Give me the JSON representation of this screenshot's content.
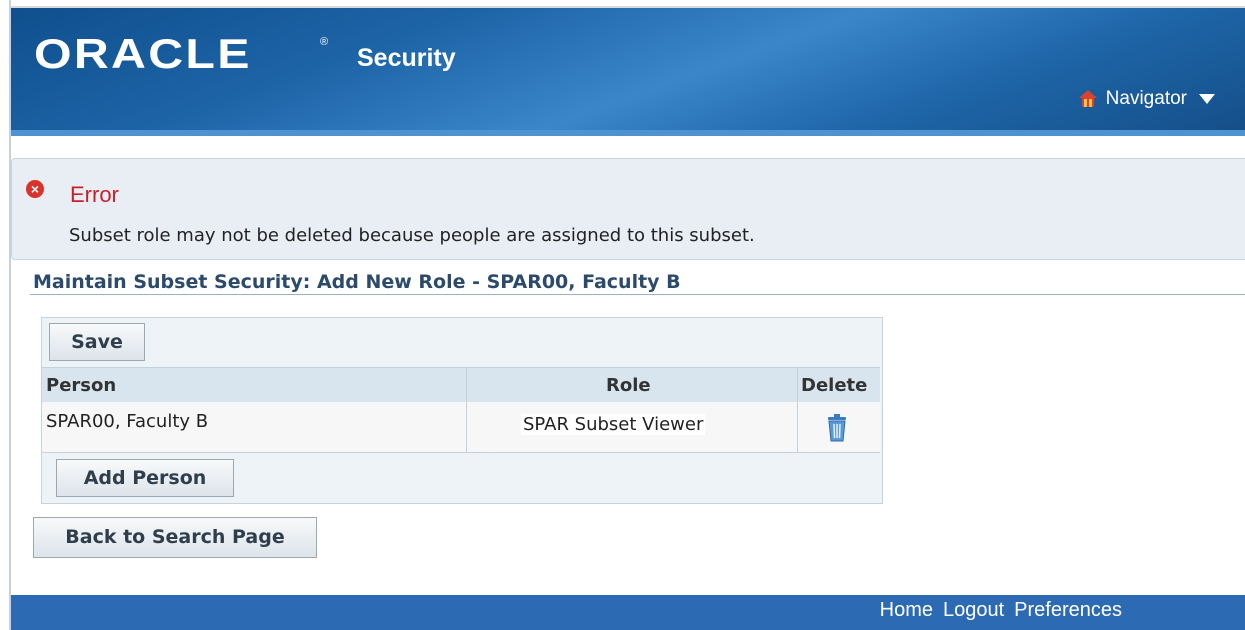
{
  "header": {
    "brand": "ORACLE",
    "brand_mark": "®",
    "app_title": "Security",
    "navigator_label": "Navigator"
  },
  "error": {
    "title": "Error",
    "message": "Subset role may not be deleted because people are assigned to this subset."
  },
  "page": {
    "title": "Maintain Subset Security: Add New Role - SPAR00, Faculty B"
  },
  "table": {
    "save_label": "Save",
    "columns": [
      "Person",
      "Role",
      "Delete"
    ],
    "rows": [
      {
        "person": "SPAR00, Faculty B",
        "role": "SPAR Subset Viewer"
      }
    ],
    "add_person_label": "Add Person"
  },
  "back_label": "Back to Search Page",
  "footer": {
    "links": [
      "Home",
      "Logout",
      "Preferences"
    ]
  },
  "icons": {
    "home": "home-icon",
    "error": "error-icon",
    "delete": "trash-icon",
    "dropdown": "caret-down-icon"
  },
  "colors": {
    "header_blue": "#1d64a6",
    "error_red": "#c8202a",
    "footer_blue": "#2c6ab3"
  }
}
